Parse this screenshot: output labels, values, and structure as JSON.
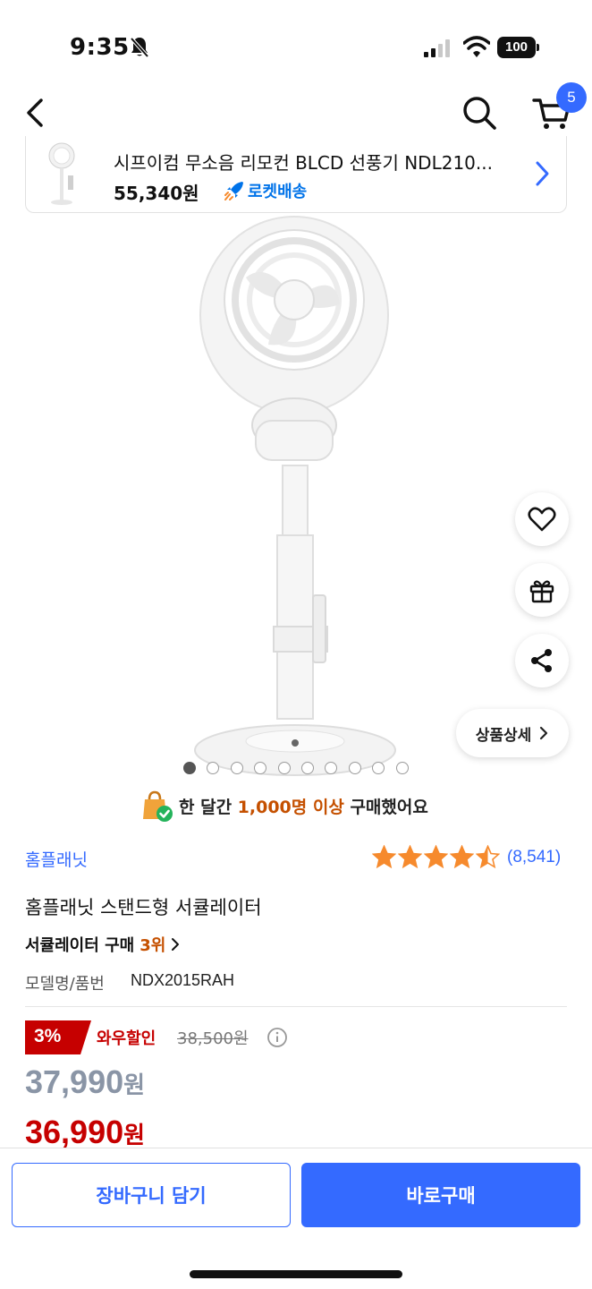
{
  "status_bar": {
    "time": "9:35",
    "battery": "100"
  },
  "header": {
    "cart_count": "5"
  },
  "sticky_card": {
    "title": "시프이컴 무소음 리모컨 BLCD 선풍기 NDL210...",
    "price": "55,340원",
    "rocket_label": "로켓배송"
  },
  "gallery": {
    "total": 10,
    "active_index": 0,
    "detail_label": "상품상세"
  },
  "notice": {
    "prefix": "한 달간 ",
    "highlight": "1,000명 이상",
    "suffix": " 구매했어요"
  },
  "product": {
    "brand": "홈플래닛",
    "rating": 4.5,
    "review_count": "(8,541)",
    "title": "홈플래닛 스탠드형 서큘레이터",
    "rank_label": "서큘레이터 구매",
    "rank_value": "3위",
    "model_label": "모델명/품번",
    "model_value": "NDX2015RAH"
  },
  "pricing": {
    "discount_rate": "3%",
    "wow_label": "와우할인",
    "original_price": "38,500원",
    "sale_price": "37,990",
    "wow_price": "36,990",
    "currency": "원"
  },
  "bottom_bar": {
    "cart_button": "장바구니 담기",
    "buy_button": "바로구매"
  },
  "colors": {
    "accent": "#346aff",
    "sale": "#c60000",
    "highlight": "#c55000",
    "star": "#f68a2d"
  },
  "icons": [
    "back-arrow-icon",
    "search-icon",
    "cart-icon",
    "rocket-icon",
    "chevron-right-icon",
    "heart-icon",
    "gift-icon",
    "share-icon",
    "shopping-bag-icon",
    "star-icon",
    "info-icon"
  ]
}
